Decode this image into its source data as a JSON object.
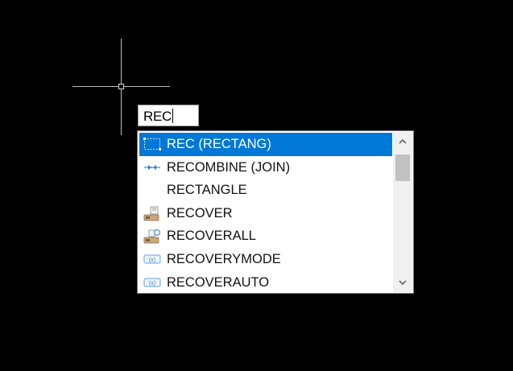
{
  "command_line": {
    "input_value": "REC"
  },
  "autocomplete": {
    "selected_index": 0,
    "items": [
      {
        "label": "REC (RECTANG)",
        "icon": "rectangle-icon"
      },
      {
        "label": "RECOMBINE (JOIN)",
        "icon": "join-icon"
      },
      {
        "label": "RECTANGLE",
        "icon": ""
      },
      {
        "label": "RECOVER",
        "icon": "recover-icon"
      },
      {
        "label": "RECOVERALL",
        "icon": "recoverall-icon"
      },
      {
        "label": "RECOVERYMODE",
        "icon": "sysvar-icon"
      },
      {
        "label": "RECOVERAUTO",
        "icon": "sysvar-icon"
      }
    ]
  },
  "colors": {
    "background": "#000000",
    "selection": "#0078d7"
  }
}
